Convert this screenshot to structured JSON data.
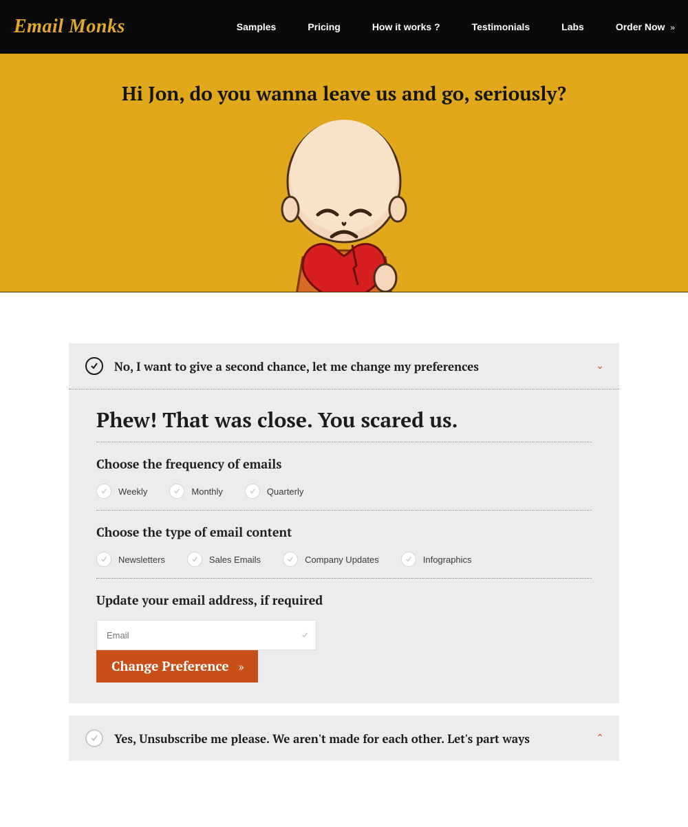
{
  "header": {
    "logo": "Email Monks",
    "nav": {
      "samples": "Samples",
      "pricing": "Pricing",
      "how": "How it works ?",
      "testimonials": "Testimonials",
      "labs": "Labs",
      "order": "Order Now"
    }
  },
  "hero": {
    "title": "Hi Jon, do you wanna leave us and go, seriously?"
  },
  "panel1": {
    "header": "No, I want to give a second chance, let me change my preferences",
    "body": {
      "heading": "Phew! That was close. You scared us.",
      "freq_label": "Choose the frequency of emails",
      "freq": {
        "weekly": "Weekly",
        "monthly": "Monthly",
        "quarterly": "Quarterly"
      },
      "type_label": "Choose the type of email content",
      "types": {
        "newsletters": "Newsletters",
        "sales": "Sales Emails",
        "company": "Company Updates",
        "infographics": "Infographics"
      },
      "email_label": "Update your email address, if required",
      "email_placeholder": "Email",
      "button": "Change Preference"
    }
  },
  "panel2": {
    "header": "Yes, Unsubscribe me please. We aren't made for each other. Let's part ways"
  }
}
